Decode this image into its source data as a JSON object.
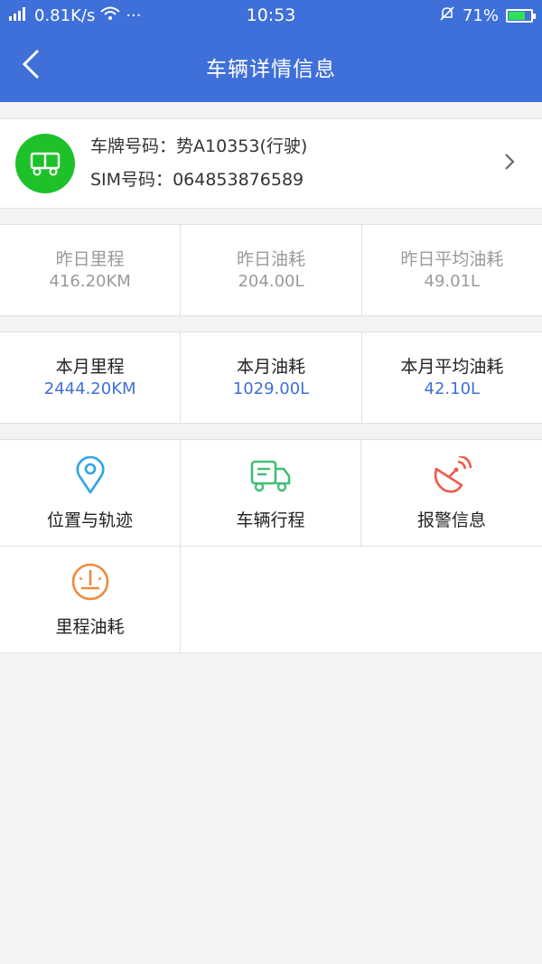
{
  "status_bar": {
    "network": "0.81K/s",
    "dots": "···",
    "time": "10:53",
    "battery_percent": "71%",
    "battery_level": 0.71
  },
  "header": {
    "title": "车辆详情信息"
  },
  "vehicle": {
    "plate_label": "车牌号码：",
    "plate": "势A10353(行驶)",
    "sim_label": "SIM号码：",
    "sim": "064853876589"
  },
  "yesterday": [
    {
      "label": "昨日里程",
      "value": "416.20KM"
    },
    {
      "label": "昨日油耗",
      "value": "204.00L"
    },
    {
      "label": "昨日平均油耗",
      "value": "49.01L"
    }
  ],
  "month": [
    {
      "label": "本月里程",
      "value": "2444.20KM"
    },
    {
      "label": "本月油耗",
      "value": "1029.00L"
    },
    {
      "label": "本月平均油耗",
      "value": "42.10L"
    }
  ],
  "menu": [
    {
      "label": "位置与轨迹",
      "icon": "location-pin-icon",
      "color": "#2ea6e6"
    },
    {
      "label": "车辆行程",
      "icon": "truck-icon",
      "color": "#3fbf75"
    },
    {
      "label": "报警信息",
      "icon": "satellite-dish-icon",
      "color": "#ee5a4d"
    },
    {
      "label": "里程油耗",
      "icon": "gauge-icon",
      "color": "#f08a3c"
    }
  ]
}
